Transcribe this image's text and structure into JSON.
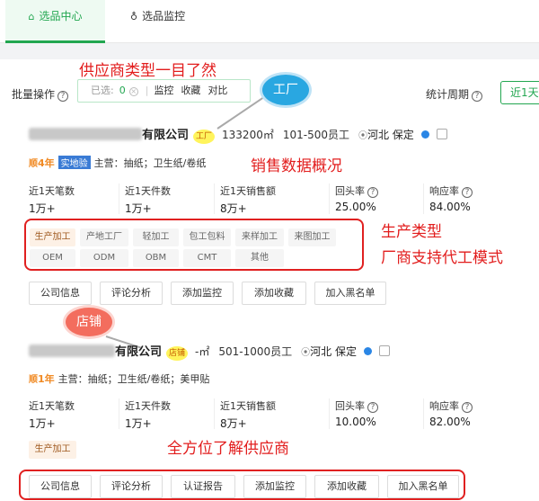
{
  "tabs": [
    {
      "label": "选品中心",
      "icon": "home-icon",
      "active": true
    },
    {
      "label": "选品监控",
      "icon": "user-icon",
      "active": false
    }
  ],
  "toolbar": {
    "batch_label": "批量操作",
    "selected_label": "已选:",
    "selected_count": "0",
    "actions": [
      "监控",
      "收藏",
      "对比"
    ],
    "period_label": "统计周期",
    "period_value": "近1天"
  },
  "annotations": {
    "supplier_types": "供应商类型一目了然",
    "badge_factory": "工厂",
    "badge_shop": "店铺",
    "sales_overview": "销售数据概况",
    "production_type_1": "生产类型",
    "production_type_2": "厂商支持代工模式",
    "full_view": "全方位了解供应商"
  },
  "suppliers": [
    {
      "name_suffix": "有限公司",
      "type_tag": "工厂",
      "area": "133200㎡",
      "staff": "101-500员工",
      "location": "河北 保定",
      "years": "4年",
      "years_mark": "顺",
      "extra_tag": "实地验",
      "main_business": "主营：抽纸；卫生纸/卷纸",
      "stats": [
        {
          "label": "近1天笔数",
          "value": "1万+"
        },
        {
          "label": "近1天件数",
          "value": "1万+"
        },
        {
          "label": "近1天销售额",
          "value": "8万+"
        },
        {
          "label": "回头率",
          "value": "25.00%",
          "help": true
        },
        {
          "label": "响应率",
          "value": "84.00%",
          "help": true
        }
      ],
      "tags": [
        "生产加工",
        "产地工厂",
        "轻加工",
        "包工包料",
        "来样加工",
        "来图加工",
        "OEM",
        "ODM",
        "OBM",
        "CMT",
        "其他"
      ],
      "buttons": [
        "公司信息",
        "评论分析",
        "添加监控",
        "添加收藏",
        "加入黑名单"
      ]
    },
    {
      "name_suffix": "有限公司",
      "type_tag": "店铺",
      "area": "-㎡",
      "staff": "501-1000员工",
      "location": "河北 保定",
      "years": "1年",
      "years_mark": "顺",
      "main_business": "主营：抽纸；卫生纸/卷纸；美甲贴",
      "stats": [
        {
          "label": "近1天笔数",
          "value": "1万+"
        },
        {
          "label": "近1天件数",
          "value": "1万+"
        },
        {
          "label": "近1天销售额",
          "value": "8万+"
        },
        {
          "label": "回头率",
          "value": "10.00%",
          "help": true
        },
        {
          "label": "响应率",
          "value": "82.00%",
          "help": true
        }
      ],
      "tags": [
        "生产加工"
      ],
      "buttons": [
        "公司信息",
        "评论分析",
        "认证报告",
        "添加监控",
        "添加收藏",
        "加入黑名单"
      ]
    }
  ],
  "colors": {
    "accent": "#22a650",
    "annotation": "#e21d1d",
    "factory_badge": "#29a7e1",
    "shop_badge": "#f36d5e"
  }
}
